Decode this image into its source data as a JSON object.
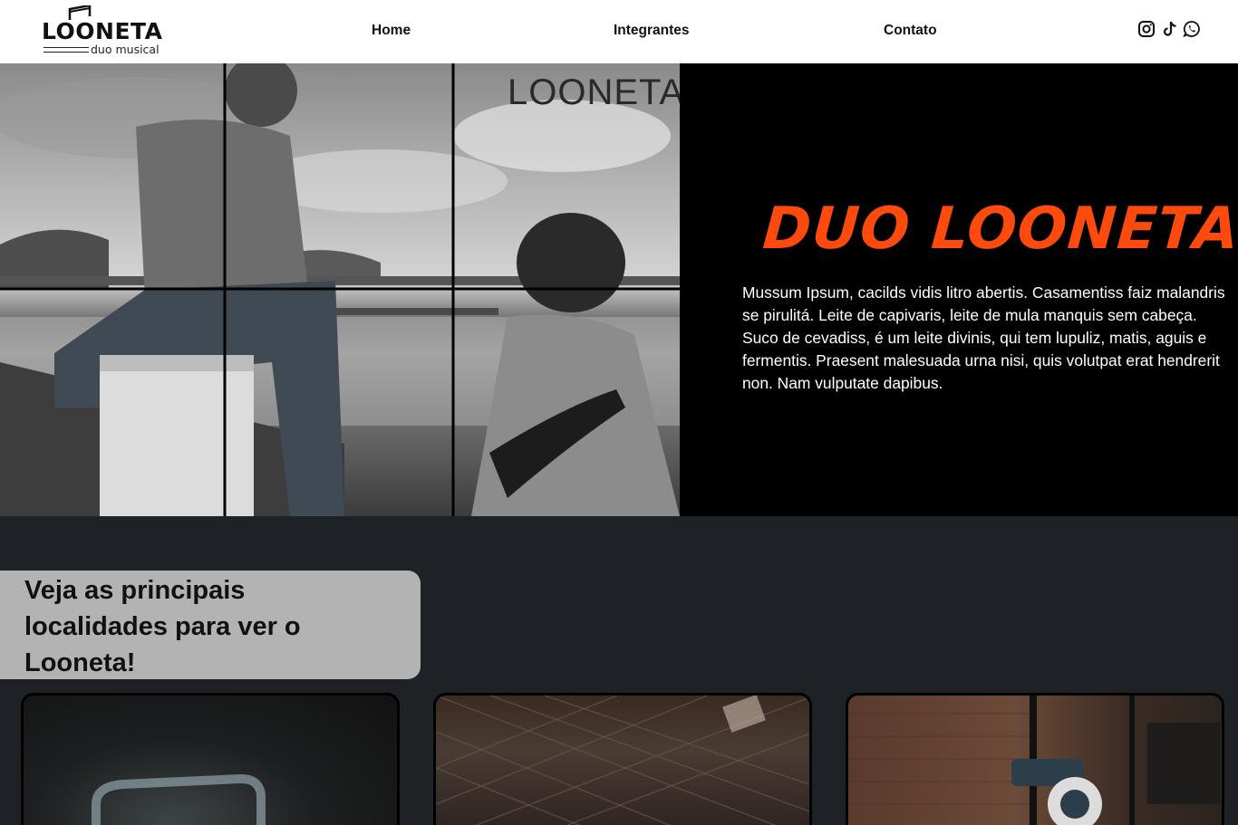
{
  "nav": {
    "logo_word": "LOONETA",
    "logo_sub": "duo musical",
    "links": [
      "Home",
      "Integrantes",
      "Contato"
    ],
    "social_icons": [
      "instagram-icon",
      "tiktok-icon",
      "whatsapp-icon"
    ]
  },
  "hero": {
    "photo_watermark": "LOONETA",
    "title": "DUO LOONETA",
    "title_color": "#ff4a0d",
    "description": "Mussum Ipsum, cacilds vidis litro abertis. Casamentiss faiz malandris se pirulitá. Leite de capivaris, leite de mula manquis sem cabeça. Suco de cevadiss, é um leite divinis, qui tem lupuliz, matis, aguis e fermentis. Praesent malesuada urna nisi, quis volutpat erat hendrerit non. Nam vulputate dapibus."
  },
  "locations": {
    "heading": "Veja as principais localidades para ver o Looneta!",
    "cards": [
      "location-photo-1",
      "location-photo-2",
      "location-photo-3"
    ]
  },
  "colors": {
    "page_bg": "#1e2126",
    "nav_bg": "#ffffff",
    "hero_bg": "#000000",
    "heading_box": "#b3b3b3"
  }
}
